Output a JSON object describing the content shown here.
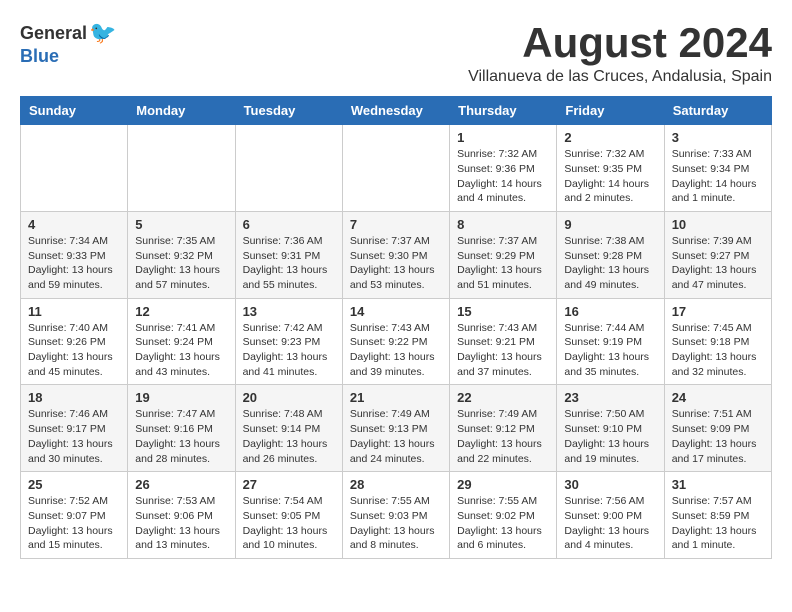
{
  "header": {
    "logo_general": "General",
    "logo_blue": "Blue",
    "month_year": "August 2024",
    "location": "Villanueva de las Cruces, Andalusia, Spain"
  },
  "days_of_week": [
    "Sunday",
    "Monday",
    "Tuesday",
    "Wednesday",
    "Thursday",
    "Friday",
    "Saturday"
  ],
  "weeks": [
    [
      {
        "day": "",
        "info": ""
      },
      {
        "day": "",
        "info": ""
      },
      {
        "day": "",
        "info": ""
      },
      {
        "day": "",
        "info": ""
      },
      {
        "day": "1",
        "info": "Sunrise: 7:32 AM\nSunset: 9:36 PM\nDaylight: 14 hours\nand 4 minutes."
      },
      {
        "day": "2",
        "info": "Sunrise: 7:32 AM\nSunset: 9:35 PM\nDaylight: 14 hours\nand 2 minutes."
      },
      {
        "day": "3",
        "info": "Sunrise: 7:33 AM\nSunset: 9:34 PM\nDaylight: 14 hours\nand 1 minute."
      }
    ],
    [
      {
        "day": "4",
        "info": "Sunrise: 7:34 AM\nSunset: 9:33 PM\nDaylight: 13 hours\nand 59 minutes."
      },
      {
        "day": "5",
        "info": "Sunrise: 7:35 AM\nSunset: 9:32 PM\nDaylight: 13 hours\nand 57 minutes."
      },
      {
        "day": "6",
        "info": "Sunrise: 7:36 AM\nSunset: 9:31 PM\nDaylight: 13 hours\nand 55 minutes."
      },
      {
        "day": "7",
        "info": "Sunrise: 7:37 AM\nSunset: 9:30 PM\nDaylight: 13 hours\nand 53 minutes."
      },
      {
        "day": "8",
        "info": "Sunrise: 7:37 AM\nSunset: 9:29 PM\nDaylight: 13 hours\nand 51 minutes."
      },
      {
        "day": "9",
        "info": "Sunrise: 7:38 AM\nSunset: 9:28 PM\nDaylight: 13 hours\nand 49 minutes."
      },
      {
        "day": "10",
        "info": "Sunrise: 7:39 AM\nSunset: 9:27 PM\nDaylight: 13 hours\nand 47 minutes."
      }
    ],
    [
      {
        "day": "11",
        "info": "Sunrise: 7:40 AM\nSunset: 9:26 PM\nDaylight: 13 hours\nand 45 minutes."
      },
      {
        "day": "12",
        "info": "Sunrise: 7:41 AM\nSunset: 9:24 PM\nDaylight: 13 hours\nand 43 minutes."
      },
      {
        "day": "13",
        "info": "Sunrise: 7:42 AM\nSunset: 9:23 PM\nDaylight: 13 hours\nand 41 minutes."
      },
      {
        "day": "14",
        "info": "Sunrise: 7:43 AM\nSunset: 9:22 PM\nDaylight: 13 hours\nand 39 minutes."
      },
      {
        "day": "15",
        "info": "Sunrise: 7:43 AM\nSunset: 9:21 PM\nDaylight: 13 hours\nand 37 minutes."
      },
      {
        "day": "16",
        "info": "Sunrise: 7:44 AM\nSunset: 9:19 PM\nDaylight: 13 hours\nand 35 minutes."
      },
      {
        "day": "17",
        "info": "Sunrise: 7:45 AM\nSunset: 9:18 PM\nDaylight: 13 hours\nand 32 minutes."
      }
    ],
    [
      {
        "day": "18",
        "info": "Sunrise: 7:46 AM\nSunset: 9:17 PM\nDaylight: 13 hours\nand 30 minutes."
      },
      {
        "day": "19",
        "info": "Sunrise: 7:47 AM\nSunset: 9:16 PM\nDaylight: 13 hours\nand 28 minutes."
      },
      {
        "day": "20",
        "info": "Sunrise: 7:48 AM\nSunset: 9:14 PM\nDaylight: 13 hours\nand 26 minutes."
      },
      {
        "day": "21",
        "info": "Sunrise: 7:49 AM\nSunset: 9:13 PM\nDaylight: 13 hours\nand 24 minutes."
      },
      {
        "day": "22",
        "info": "Sunrise: 7:49 AM\nSunset: 9:12 PM\nDaylight: 13 hours\nand 22 minutes."
      },
      {
        "day": "23",
        "info": "Sunrise: 7:50 AM\nSunset: 9:10 PM\nDaylight: 13 hours\nand 19 minutes."
      },
      {
        "day": "24",
        "info": "Sunrise: 7:51 AM\nSunset: 9:09 PM\nDaylight: 13 hours\nand 17 minutes."
      }
    ],
    [
      {
        "day": "25",
        "info": "Sunrise: 7:52 AM\nSunset: 9:07 PM\nDaylight: 13 hours\nand 15 minutes."
      },
      {
        "day": "26",
        "info": "Sunrise: 7:53 AM\nSunset: 9:06 PM\nDaylight: 13 hours\nand 13 minutes."
      },
      {
        "day": "27",
        "info": "Sunrise: 7:54 AM\nSunset: 9:05 PM\nDaylight: 13 hours\nand 10 minutes."
      },
      {
        "day": "28",
        "info": "Sunrise: 7:55 AM\nSunset: 9:03 PM\nDaylight: 13 hours\nand 8 minutes."
      },
      {
        "day": "29",
        "info": "Sunrise: 7:55 AM\nSunset: 9:02 PM\nDaylight: 13 hours\nand 6 minutes."
      },
      {
        "day": "30",
        "info": "Sunrise: 7:56 AM\nSunset: 9:00 PM\nDaylight: 13 hours\nand 4 minutes."
      },
      {
        "day": "31",
        "info": "Sunrise: 7:57 AM\nSunset: 8:59 PM\nDaylight: 13 hours\nand 1 minute."
      }
    ]
  ]
}
